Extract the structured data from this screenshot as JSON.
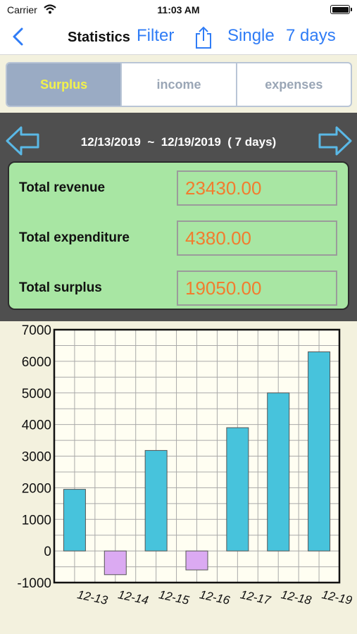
{
  "status": {
    "carrier": "Carrier",
    "time": "11:03 AM"
  },
  "nav": {
    "title": "Statistics",
    "filter": "Filter",
    "single": "Single",
    "days": "7 days",
    "back_icon": "chevron-left-icon",
    "share_icon": "share-icon"
  },
  "tabs": [
    {
      "label": "Surplus",
      "active": true
    },
    {
      "label": "income",
      "active": false
    },
    {
      "label": "expenses",
      "active": false
    }
  ],
  "range": {
    "text": "12/13/2019  ~  12/19/2019  ( 7 days)"
  },
  "summary": {
    "revenue_label": "Total revenue",
    "revenue_value": "23430.00",
    "expenditure_label": "Total expenditure",
    "expenditure_value": "4380.00",
    "surplus_label": "Total surplus",
    "surplus_value": "19050.00"
  },
  "colors": {
    "accent": "#2f7cf6",
    "positive_bar": "#47c3dc",
    "negative_bar": "#dbaaf2",
    "value_text": "#f27c2e",
    "card": "#a8e6a3"
  },
  "chart_data": {
    "type": "bar",
    "categories": [
      "12-13",
      "12-14",
      "12-15",
      "12-16",
      "12-17",
      "12-18",
      "12-19"
    ],
    "values": [
      1950,
      -750,
      3180,
      -600,
      3900,
      5000,
      6300
    ],
    "ylim": [
      -1000,
      7000
    ],
    "yticks": [
      7000,
      6000,
      5000,
      4000,
      3000,
      2000,
      1000,
      0,
      -1000
    ],
    "grid": true
  }
}
